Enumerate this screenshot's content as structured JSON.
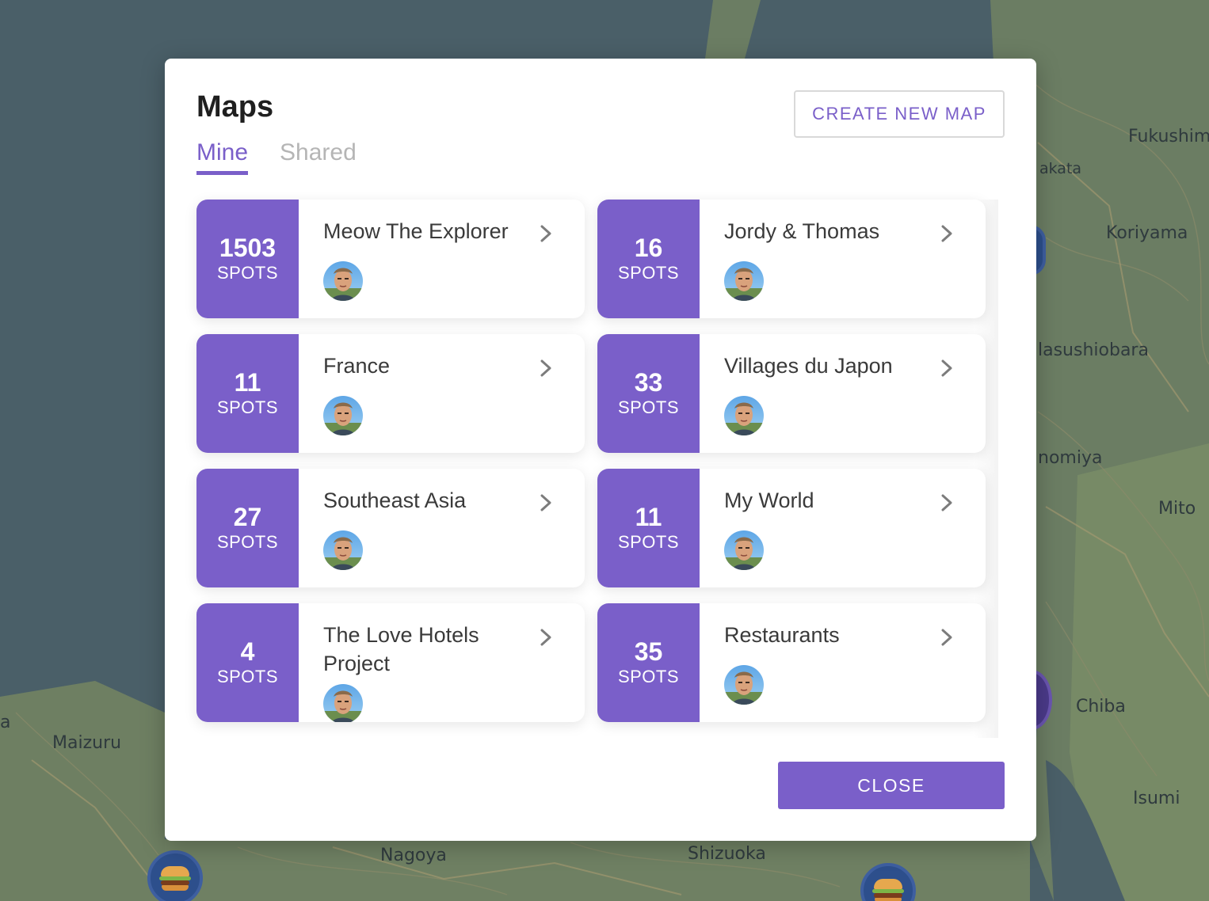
{
  "map": {
    "labels": [
      {
        "text": "Fukushim"
      },
      {
        "text": "akata"
      },
      {
        "text": "Koriyama"
      },
      {
        "text": "lasushiobara"
      },
      {
        "text": "nomiya"
      },
      {
        "text": "Mito"
      },
      {
        "text": "Chiba"
      },
      {
        "text": "Isumi"
      },
      {
        "text": "Maizuru"
      },
      {
        "text": "Nagoya"
      },
      {
        "text": "Shizuoka"
      },
      {
        "text": "a"
      }
    ]
  },
  "modal": {
    "title": "Maps",
    "create_button": "CREATE NEW MAP",
    "tabs": [
      {
        "label": "Mine",
        "active": true
      },
      {
        "label": "Shared",
        "active": false
      }
    ],
    "close_button": "CLOSE",
    "accent_color": "#7a5fc9",
    "count_label": "SPOTS",
    "maps": [
      {
        "count": "1503",
        "unit": "SPOTS",
        "name": "Meow The Explorer"
      },
      {
        "count": "16",
        "unit": "SPOTS",
        "name": "Jordy & Thomas"
      },
      {
        "count": "11",
        "unit": "SPOTS",
        "name": "France"
      },
      {
        "count": "33",
        "unit": "SPOTS",
        "name": "Villages du Japon"
      },
      {
        "count": "27",
        "unit": "SPOTS",
        "name": "Southeast Asia"
      },
      {
        "count": "11",
        "unit": "SPOTS",
        "name": "My World"
      },
      {
        "count": "4",
        "unit": "SPOTS",
        "name": "The Love Hotels Project"
      },
      {
        "count": "35",
        "unit": "SPOTS",
        "name": "Restaurants"
      }
    ]
  }
}
